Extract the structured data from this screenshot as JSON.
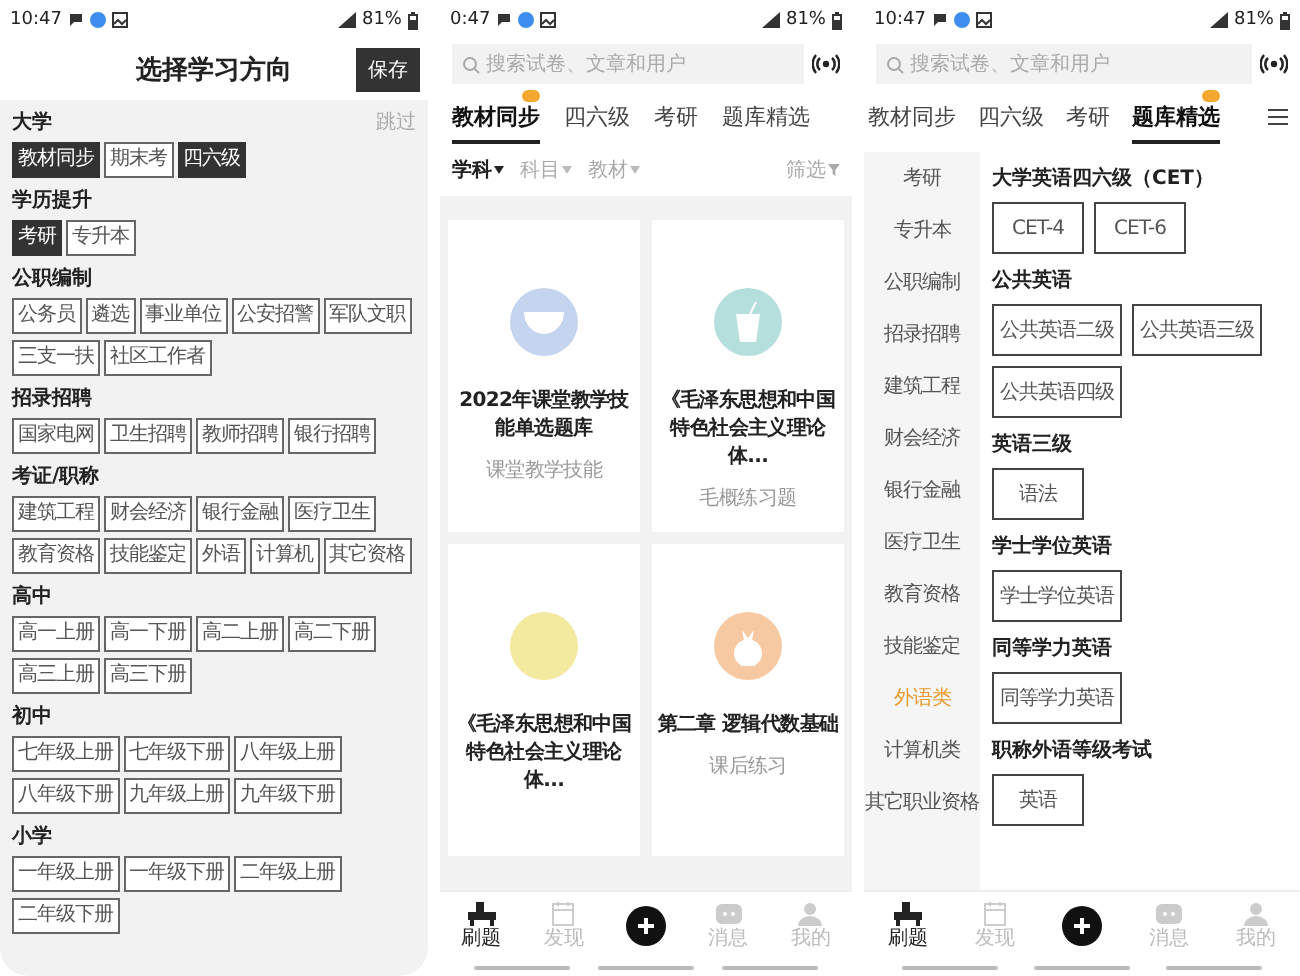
{
  "screens": [
    {
      "kind": "direction_picker",
      "status_bar": {
        "time": "10:47",
        "battery": "81%"
      },
      "title": "选择学习方向",
      "save_button": "保存",
      "skip_link": "跳过",
      "groups": [
        {
          "title": "大学",
          "chips": [
            {
              "label": "教材同步",
              "selected": true
            },
            {
              "label": "期末考",
              "selected": false
            },
            {
              "label": "四六级",
              "selected": true
            }
          ]
        },
        {
          "title": "学历提升",
          "chips": [
            {
              "label": "考研",
              "selected": true
            },
            {
              "label": "专升本",
              "selected": false
            }
          ]
        },
        {
          "title": "公职编制",
          "chips": [
            {
              "label": "公务员",
              "selected": false
            },
            {
              "label": "遴选",
              "selected": false
            },
            {
              "label": "事业单位",
              "selected": false
            },
            {
              "label": "公安招警",
              "selected": false
            },
            {
              "label": "军队文职",
              "selected": false
            },
            {
              "label": "三支一扶",
              "selected": false
            },
            {
              "label": "社区工作者",
              "selected": false
            }
          ]
        },
        {
          "title": "招录招聘",
          "chips": [
            {
              "label": "国家电网",
              "selected": false
            },
            {
              "label": "卫生招聘",
              "selected": false
            },
            {
              "label": "教师招聘",
              "selected": false
            },
            {
              "label": "银行招聘",
              "selected": false
            }
          ]
        },
        {
          "title": "考证/职称",
          "chips": [
            {
              "label": "建筑工程",
              "selected": false
            },
            {
              "label": "财会经济",
              "selected": false
            },
            {
              "label": "银行金融",
              "selected": false
            },
            {
              "label": "医疗卫生",
              "selected": false
            },
            {
              "label": "教育资格",
              "selected": false
            },
            {
              "label": "技能鉴定",
              "selected": false
            },
            {
              "label": "外语",
              "selected": false
            },
            {
              "label": "计算机",
              "selected": false
            },
            {
              "label": "其它资格",
              "selected": false
            }
          ]
        },
        {
          "title": "高中",
          "chips": [
            {
              "label": "高一上册",
              "selected": false
            },
            {
              "label": "高一下册",
              "selected": false
            },
            {
              "label": "高二上册",
              "selected": false
            },
            {
              "label": "高二下册",
              "selected": false
            },
            {
              "label": "高三上册",
              "selected": false
            },
            {
              "label": "高三下册",
              "selected": false
            }
          ]
        },
        {
          "title": "初中",
          "chips": [
            {
              "label": "七年级上册",
              "selected": false
            },
            {
              "label": "七年级下册",
              "selected": false
            },
            {
              "label": "八年级上册",
              "selected": false
            },
            {
              "label": "八年级下册",
              "selected": false
            },
            {
              "label": "九年级上册",
              "selected": false
            },
            {
              "label": "九年级下册",
              "selected": false
            }
          ]
        },
        {
          "title": "小学",
          "chips": [
            {
              "label": "一年级上册",
              "selected": false
            },
            {
              "label": "一年级下册",
              "selected": false
            },
            {
              "label": "二年级上册",
              "selected": false
            },
            {
              "label": "二年级下册",
              "selected": false
            }
          ]
        }
      ]
    },
    {
      "kind": "feed",
      "status_bar": {
        "time": "0:47",
        "battery": "81%"
      },
      "search": {
        "placeholder": "搜索试卷、文章和用户"
      },
      "tabs": [
        {
          "label": "教材同步",
          "selected": true,
          "hot": true
        },
        {
          "label": "四六级",
          "selected": false,
          "hot": false
        },
        {
          "label": "考研",
          "selected": false,
          "hot": false
        },
        {
          "label": "题库精选",
          "selected": false,
          "hot": false
        }
      ],
      "filters": [
        {
          "label": "学科",
          "selected": true
        },
        {
          "label": "科目",
          "selected": false
        },
        {
          "label": "教材",
          "selected": false
        }
      ],
      "filter_button": "筛选",
      "cards": [
        {
          "title": "2022年课堂教学技能单选题库",
          "subtitle": "课堂教学技能",
          "kind": "bowl",
          "color": "#c5d5ef"
        },
        {
          "title": "《毛泽东思想和中国特色社会主义理论体...",
          "subtitle": "毛概练习题",
          "kind": "cup",
          "color": "#b5dfdc"
        },
        {
          "title": "《毛泽东思想和中国特色社会主义理论体...",
          "kind": "grain",
          "color": "#f3eaa0"
        },
        {
          "title": "第二章 逻辑代数基础",
          "subtitle": "课后练习",
          "kind": "sack",
          "color": "#f6c9a2"
        }
      ],
      "nav": [
        {
          "kind": "desk",
          "label": "刷题",
          "selected": true
        },
        {
          "kind": "notebook",
          "label": "发现",
          "selected": false
        },
        {
          "kind": "add"
        },
        {
          "kind": "chat",
          "label": "消息",
          "selected": false
        },
        {
          "kind": "person",
          "label": "我的",
          "selected": false
        }
      ]
    },
    {
      "kind": "catalog",
      "status_bar": {
        "time": "10:47",
        "battery": "81%"
      },
      "search": {
        "placeholder": "搜索试卷、文章和用户"
      },
      "tabs": [
        {
          "label": "教材同步",
          "selected": false,
          "hot": false
        },
        {
          "label": "四六级",
          "selected": false,
          "hot": false
        },
        {
          "label": "考研",
          "selected": false,
          "hot": false
        },
        {
          "label": "题库精选",
          "selected": true,
          "hot": true
        }
      ],
      "categories": [
        {
          "label": "考研",
          "selected": false
        },
        {
          "label": "专升本",
          "selected": false
        },
        {
          "label": "公职编制",
          "selected": false
        },
        {
          "label": "招录招聘",
          "selected": false
        },
        {
          "label": "建筑工程",
          "selected": false
        },
        {
          "label": "财会经济",
          "selected": false
        },
        {
          "label": "银行金融",
          "selected": false
        },
        {
          "label": "医疗卫生",
          "selected": false
        },
        {
          "label": "教育资格",
          "selected": false
        },
        {
          "label": "技能鉴定",
          "selected": false
        },
        {
          "label": "外语类",
          "selected": true
        },
        {
          "label": "计算机类",
          "selected": false
        },
        {
          "label": "其它职业资格",
          "selected": false
        }
      ],
      "sections": [
        {
          "title": "大学英语四六级（CET）",
          "options": [
            "CET-4",
            "CET-6"
          ]
        },
        {
          "title": "公共英语",
          "options": [
            "公共英语二级",
            "公共英语三级",
            "公共英语四级"
          ]
        },
        {
          "title": "英语三级",
          "options": [
            "语法"
          ]
        },
        {
          "title": "学士学位英语",
          "options": [
            "学士学位英语"
          ]
        },
        {
          "title": "同等学力英语",
          "options": [
            "同等学力英语"
          ]
        },
        {
          "title": "职称外语等级考试",
          "options": [
            "英语"
          ]
        }
      ],
      "nav": [
        {
          "kind": "desk",
          "label": "刷题",
          "selected": true
        },
        {
          "kind": "notebook",
          "label": "发现",
          "selected": false
        },
        {
          "kind": "add"
        },
        {
          "kind": "chat",
          "label": "消息",
          "selected": false
        },
        {
          "kind": "person",
          "label": "我的",
          "selected": false
        }
      ]
    }
  ]
}
